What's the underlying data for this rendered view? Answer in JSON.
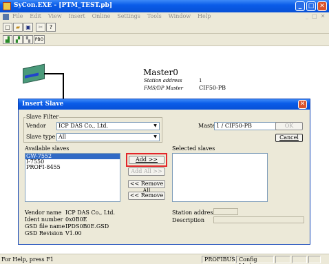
{
  "window": {
    "title": "SyCon.EXE - [PTM_TEST.pb]"
  },
  "menu": [
    "File",
    "Edit",
    "View",
    "Insert",
    "Online",
    "Settings",
    "Tools",
    "Window",
    "Help"
  ],
  "toolbar2": {
    "pbo_label": "PBO"
  },
  "master": {
    "name": "Master0",
    "station_label": "Station address",
    "station_value": "1",
    "type_label": "FMS/DP Master",
    "type_value": "CIF50-PB"
  },
  "dialog": {
    "title": "Insert Slave",
    "filter_group": "Slave Filter",
    "vendor_label": "Vendor",
    "vendor_value": "ICP DAS Co., Ltd.",
    "slave_type_label": "Slave type",
    "slave_type_value": "All",
    "master_label": "Master",
    "master_value": "1 / CIF50-PB",
    "ok_label": "OK",
    "cancel_label": "Cancel",
    "available_label": "Available slaves",
    "available_slaves": [
      "GW-7552",
      "I-7550",
      "PROFI-8455"
    ],
    "selected_label": "Selected slaves",
    "add_label": "Add >>",
    "add_all_label": "Add All >>",
    "remove_all_label": "<< Remove All",
    "remove_label": "<< Remove",
    "vendor_name_label": "Vendor name",
    "vendor_name_value": "ICP DAS Co., Ltd.",
    "ident_label": "Ident number",
    "ident_value": "0x0B0E",
    "gsd_label": "GSD file name",
    "gsd_value": "IPDS0B0E.GSD",
    "gsd_rev_label": "GSD Revision",
    "gsd_rev_value": "V1.00",
    "station_address_label": "Station address",
    "description_label": "Description"
  },
  "status": {
    "help": "For Help, press F1",
    "bus": "PROFIBUS",
    "mode": "Config Mode"
  }
}
